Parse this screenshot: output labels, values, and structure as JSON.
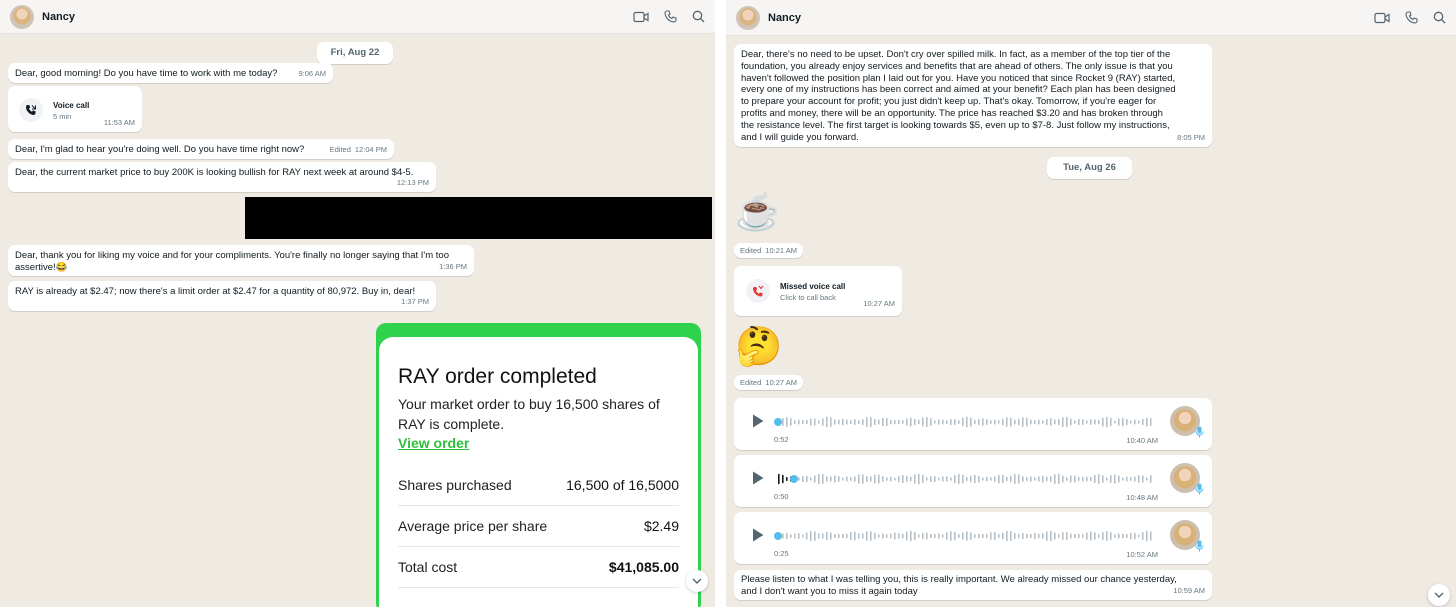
{
  "contact": {
    "name": "Nancy"
  },
  "left": {
    "date_chip": "Fri, Aug 22",
    "messages": [
      {
        "text": "Dear, good morning! Do you have time to work with me today?",
        "time": "9:06 AM"
      },
      {
        "text": "Dear, I'm glad to hear you're doing well. Do you have time right now?",
        "edited": "Edited",
        "time": "12:04 PM"
      },
      {
        "text": "Dear, the current market price to buy 200K is looking bullish for RAY next week at around $4-5.",
        "time": "12:13 PM"
      },
      {
        "line1": "Dear, thank you for liking my voice and for your compliments. You're finally no longer saying that I'm too",
        "line2": "assertive!😂",
        "time": "1:36 PM"
      },
      {
        "text": "RAY is already at $2.47; now there's a limit order at $2.47 for a quantity of 80,972. Buy in, dear!",
        "time": "1:37 PM"
      }
    ],
    "voice_call": {
      "title": "Voice call",
      "duration": "5 min",
      "time": "11:53 AM"
    },
    "order": {
      "title": "RAY order completed",
      "description": "Your market order to buy 16,500 shares of RAY is complete.",
      "link": "View order",
      "rows": [
        {
          "label": "Shares purchased",
          "value": "16,500 of 16,5000"
        },
        {
          "label": "Average price per share",
          "value": "$2.49"
        },
        {
          "label": "Total cost",
          "value": "$41,085.00"
        }
      ],
      "accent": "#2fd24c"
    }
  },
  "right": {
    "long_message": {
      "lines": [
        "Dear, there's no need to be upset. Don't cry over spilled milk. In fact, as a member of the top tier of the",
        "foundation, you already enjoy services and benefits that are ahead of others. The only issue is that you",
        "haven't followed the position plan I laid out for you. Have you noticed that since Rocket 9 (RAY) started,",
        "every one of my instructions has been correct and aimed at your benefit? Each plan has been designed",
        "to prepare your account for profit; you just didn't keep up. That's okay. Tomorrow, if you're eager for",
        "profits and money, there will be an opportunity. The price has reached $3.20 and has broken through",
        "the resistance level. The first target is looking towards $5, even up to $7-8. Just follow my instructions,",
        "and I will guide you forward."
      ],
      "time": "8:05 PM"
    },
    "date_chip": "Tue, Aug 26",
    "coffee": {
      "emoji": "☕",
      "edited": "Edited",
      "time": "10:21 AM"
    },
    "missed_call": {
      "title": "Missed voice call",
      "subtitle": "Click to call back",
      "time": "10:27 AM"
    },
    "thinking": {
      "emoji": "🤔",
      "edited": "Edited",
      "time": "10:27 AM"
    },
    "voice_notes": [
      {
        "duration": "0:52",
        "time": "10:40 AM",
        "progress": 0.0
      },
      {
        "duration": "0:50",
        "time": "10:48 AM",
        "progress": 0.04
      },
      {
        "duration": "0:25",
        "time": "10:52 AM",
        "progress": 0.0
      }
    ],
    "last_message": {
      "line1": "Please listen to what I was telling you, this is really important. We already missed our chance yesterday,",
      "line2": "and I don't want you to miss it again today",
      "time": "10:59 AM"
    }
  },
  "icons": [
    "video-call-icon",
    "phone-icon",
    "search-icon",
    "chevron-down-icon",
    "play-icon",
    "microphone-icon",
    "missed-call-icon"
  ],
  "colors": {
    "chat_bg": "#efeae2",
    "bubble": "#ffffff",
    "accent_blue": "#53bdeb",
    "missed_red": "#e53935"
  }
}
